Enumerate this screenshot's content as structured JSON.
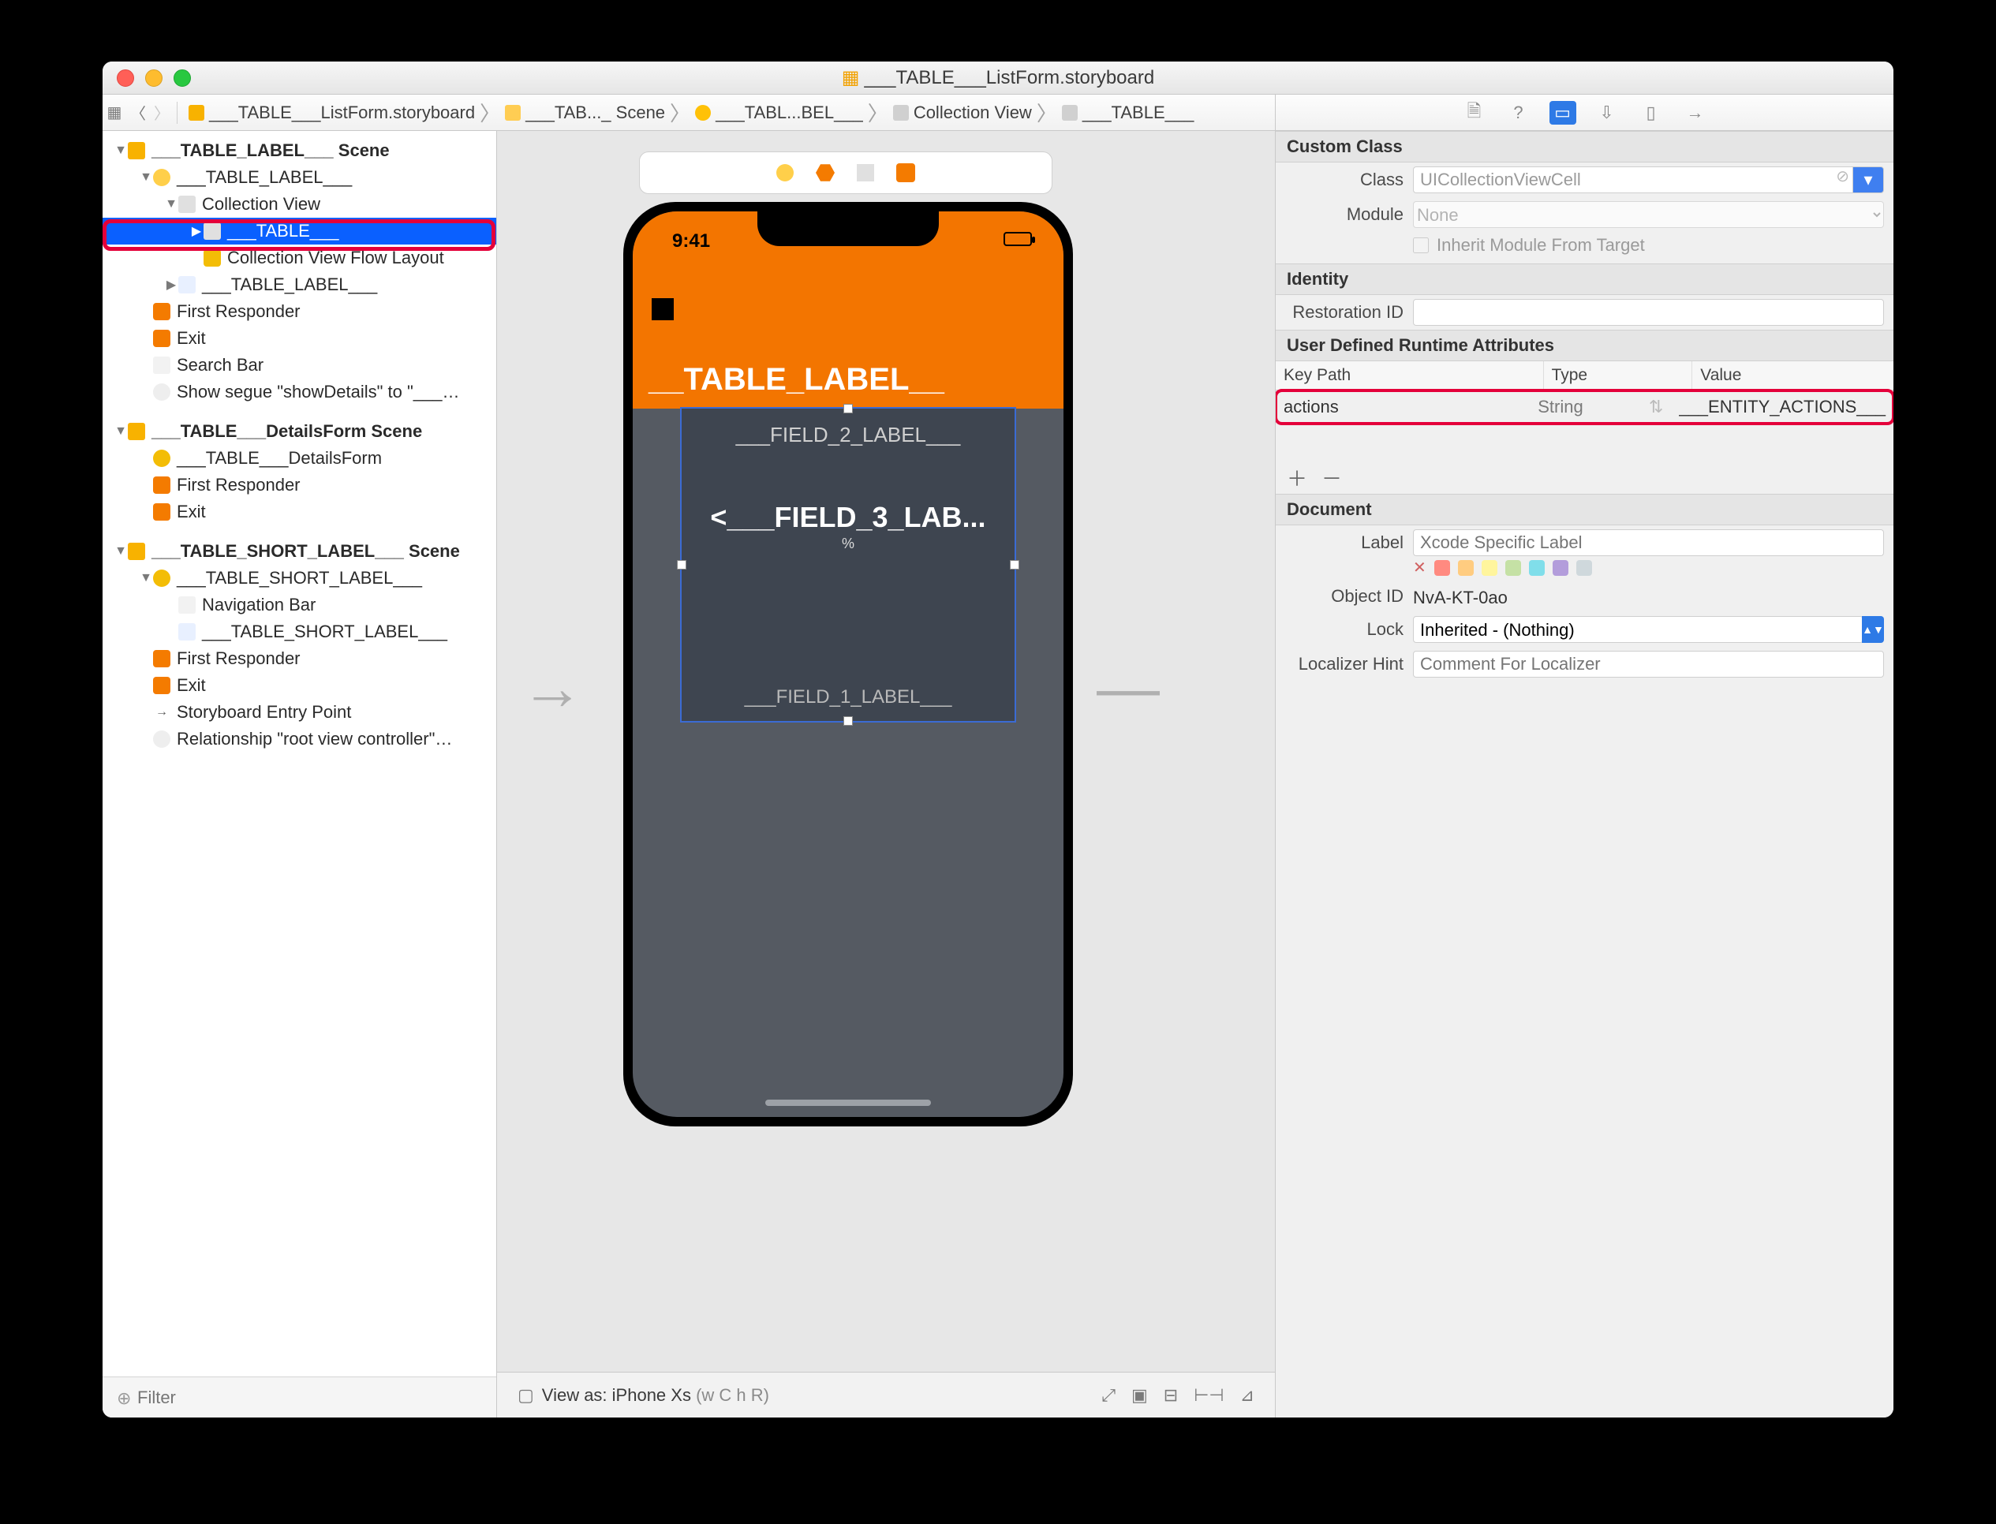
{
  "title": "___TABLE___ListForm.storyboard",
  "breadcrumb": [
    {
      "label": "___TABLE___ListForm.storyboard",
      "icon": "ic-sb"
    },
    {
      "label": "___TAB..._ Scene",
      "icon": "ic-scene"
    },
    {
      "label": "___TABL...BEL___",
      "icon": "ic-vc"
    },
    {
      "label": "Collection View",
      "icon": "ic-cv"
    },
    {
      "label": "___TABLE___",
      "icon": "ic-cv"
    }
  ],
  "outline": {
    "filter_placeholder": "Filter",
    "scenes": [
      {
        "label": "___TABLE_LABEL___ Scene",
        "depth": 0,
        "bold": true,
        "icon": "ic-folder",
        "disc": "▼"
      },
      {
        "label": "___TABLE_LABEL___",
        "depth": 1,
        "icon": "ic-yellow",
        "disc": "▼"
      },
      {
        "label": "Collection View",
        "depth": 2,
        "icon": "ic-grid",
        "disc": "▼"
      },
      {
        "label": "___TABLE___",
        "depth": 3,
        "icon": "ic-cell",
        "disc": "▶",
        "selected": true
      },
      {
        "label": "Collection View Flow Layout",
        "depth": 3,
        "icon": "ic-flow"
      },
      {
        "label": "___TABLE_LABEL___",
        "depth": 2,
        "icon": "ic-star",
        "disc": "▶"
      },
      {
        "label": "First Responder",
        "depth": 1,
        "icon": "ic-fr"
      },
      {
        "label": "Exit",
        "depth": 1,
        "icon": "ic-exit"
      },
      {
        "label": "Search Bar",
        "depth": 1,
        "icon": "ic-txt"
      },
      {
        "label": "Show segue \"showDetails\" to \"___…",
        "depth": 1,
        "icon": "ic-seg"
      },
      {
        "label": "___TABLE___DetailsForm Scene",
        "depth": 0,
        "bold": true,
        "icon": "ic-folder",
        "disc": "▼",
        "gap": true
      },
      {
        "label": "___TABLE___DetailsForm",
        "depth": 1,
        "icon": "ic-nav"
      },
      {
        "label": "First Responder",
        "depth": 1,
        "icon": "ic-fr"
      },
      {
        "label": "Exit",
        "depth": 1,
        "icon": "ic-exit"
      },
      {
        "label": "___TABLE_SHORT_LABEL___ Scene",
        "depth": 0,
        "bold": true,
        "icon": "ic-folder",
        "disc": "▼",
        "gap": true
      },
      {
        "label": "___TABLE_SHORT_LABEL___",
        "depth": 1,
        "icon": "ic-nav",
        "disc": "▼"
      },
      {
        "label": "Navigation Bar",
        "depth": 2,
        "icon": "ic-txt"
      },
      {
        "label": "___TABLE_SHORT_LABEL___",
        "depth": 2,
        "icon": "ic-star"
      },
      {
        "label": "First Responder",
        "depth": 1,
        "icon": "ic-fr"
      },
      {
        "label": "Exit",
        "depth": 1,
        "icon": "ic-exit"
      },
      {
        "label": "Storyboard Entry Point",
        "depth": 1,
        "icon": "ic-seg",
        "arrow": true
      },
      {
        "label": "Relationship \"root view controller\"…",
        "depth": 1,
        "icon": "ic-seg"
      }
    ]
  },
  "canvas": {
    "time": "9:41",
    "header_label": "__TABLE_LABEL__",
    "field2": "___FIELD_2_LABEL___",
    "field3": "<___FIELD_3_LAB...",
    "field3_pct": "%",
    "field1": "___FIELD_1_LABEL___",
    "footer_left": "View as: iPhone Xs",
    "footer_wchr": "(w C  h R)"
  },
  "inspector": {
    "custom_class": {
      "title": "Custom Class",
      "class_label": "Class",
      "class_value": "UICollectionViewCell",
      "module_label": "Module",
      "module_value": "None",
      "inherit_label": "Inherit Module From Target"
    },
    "identity": {
      "title": "Identity",
      "restoration_label": "Restoration ID",
      "restoration_value": ""
    },
    "runtime": {
      "title": "User Defined Runtime Attributes",
      "col_kp": "Key Path",
      "col_ty": "Type",
      "col_va": "Value",
      "row": {
        "keypath": "actions",
        "type": "String",
        "value": "___ENTITY_ACTIONS___"
      }
    },
    "document": {
      "title": "Document",
      "label_label": "Label",
      "label_ph": "Xcode Specific Label",
      "object_label": "Object ID",
      "object_value": "NvA-KT-0ao",
      "lock_label": "Lock",
      "lock_value": "Inherited - (Nothing)",
      "locz_label": "Localizer Hint",
      "locz_ph": "Comment For Localizer",
      "swatches": [
        "#ff8a80",
        "#ffcc80",
        "#fff59d",
        "#c5e1a5",
        "#80deea",
        "#b39ddb",
        "#bcaaa4",
        "#cfd8dc"
      ]
    }
  }
}
